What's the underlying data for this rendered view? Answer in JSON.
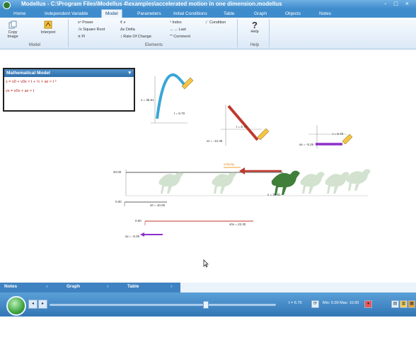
{
  "window": {
    "title": "Modellus - C:\\Program Files\\Modellus 4\\examples\\accelerated motion in one dimension.modellus",
    "controls": "- □ ×"
  },
  "tabs": [
    "Home",
    "Independent Variable",
    "Model",
    "Parameters",
    "Initial Conditions",
    "Table",
    "Graph",
    "Objects",
    "Notes"
  ],
  "ribbon": {
    "copy_image": "Copy Image",
    "interpret": "Interpret",
    "model_group": "Model",
    "power": "xⁿ  Power",
    "sqrt": "√x  Square Root",
    "pi": "π  Pi",
    "x_letter": "¢  x",
    "delta": "Δx  Delta",
    "rate": "↕  Rate Of Change",
    "index": "ˣ  Index",
    "last": "←→  Last",
    "comment": "ˮˮ  Comment",
    "condition": "↕ˉ  Condition",
    "elements_group": "Elements",
    "help_symbol": "?",
    "help_label": "Help",
    "help_group": "Help"
  },
  "model_panel": {
    "title": "Mathematical Model",
    "eq1": "x = x0 + v0x × t + ½ × ax × t ²",
    "eq2": "vx = v0x + ax × t"
  },
  "readouts": {
    "graph1_y": "x = 35.61",
    "graph1_t": "t = 6.70",
    "graph2_v": "vx = -12.46",
    "graph2_t": "t = 6.70",
    "graph3_a": "ax = -5.26",
    "graph3_t": "t = 6.70",
    "velocity_label": "velocity",
    "track_left": "40.00",
    "track_x": "x = 35.61",
    "x0_tick": "0.00",
    "x0_value": "x0 = 10.00",
    "v0_tick": "0.00",
    "v0_value": "v0x = 22.30",
    "ax_value": "ax = -5.26"
  },
  "panes": [
    "Notes",
    "Graph",
    "Table"
  ],
  "status": {
    "time": "t = 6.70",
    "min_max": "Min: 0.00  Max: 10.00"
  },
  "colors": {
    "curve_blue": "#3aa6d6",
    "line_red": "#c0392b",
    "line_purple": "#8e2fc9",
    "dino_green": "#3f7f3a"
  }
}
